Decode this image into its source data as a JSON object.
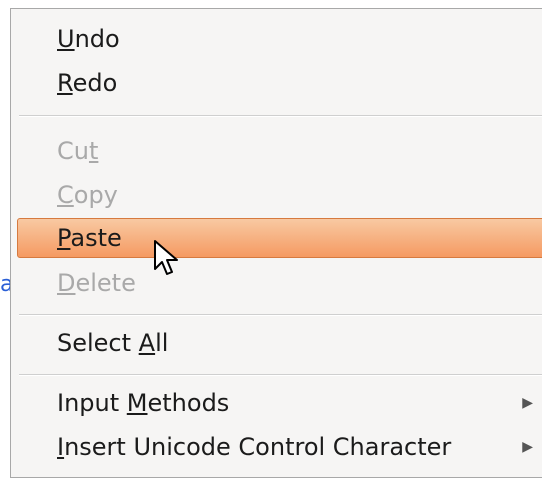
{
  "background": {
    "fragment_text": "a",
    "fragment_color": "#2a5fd6"
  },
  "context_menu": {
    "items": [
      {
        "pre": "",
        "mnemonic": "U",
        "post": "ndo",
        "enabled": true
      },
      {
        "pre": "",
        "mnemonic": "R",
        "post": "edo",
        "enabled": true
      },
      {
        "pre": "Cu",
        "mnemonic": "t",
        "post": "",
        "enabled": false
      },
      {
        "pre": "",
        "mnemonic": "C",
        "post": "opy",
        "enabled": false
      },
      {
        "pre": "",
        "mnemonic": "P",
        "post": "aste",
        "enabled": true,
        "highlighted": true
      },
      {
        "pre": "",
        "mnemonic": "D",
        "post": "elete",
        "enabled": false
      },
      {
        "pre": "Select ",
        "mnemonic": "A",
        "post": "ll",
        "enabled": true
      },
      {
        "pre": "Input ",
        "mnemonic": "M",
        "post": "ethods",
        "enabled": true,
        "submenu": true
      },
      {
        "pre": "",
        "mnemonic": "I",
        "post": "nsert Unicode Control Character",
        "enabled": true,
        "submenu": true
      }
    ],
    "submenu_arrow": "▶",
    "highlight_color": "#f59a62"
  },
  "cursor": {
    "icon": "mouse-pointer-icon"
  }
}
